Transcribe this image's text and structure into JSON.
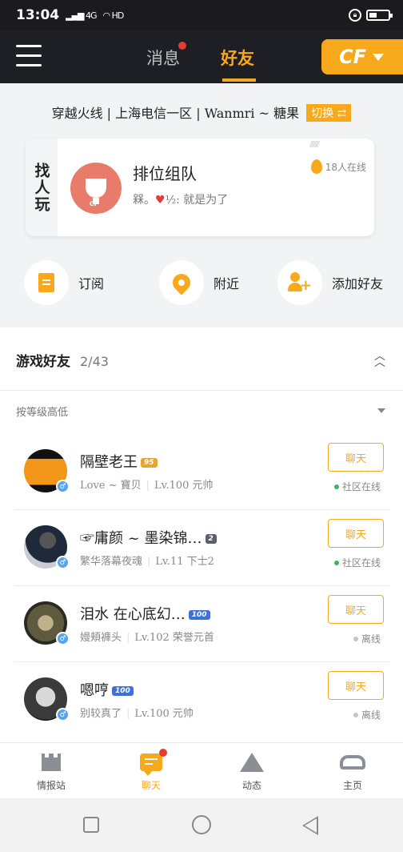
{
  "status_bar": {
    "time": "13:04",
    "network": "4G",
    "wifi": "HD"
  },
  "top_nav": {
    "tab_messages": "消息",
    "tab_friends": "好友",
    "game_button": "CF"
  },
  "server": {
    "text": "穿越火线 | 上海电信一区 | Wanmri ~ 糖果",
    "switch_label": "切换 ⇄"
  },
  "find_player": {
    "tag": "找人玩",
    "title": "排位组队",
    "subtitle_pre": "槑。",
    "subtitle_post": "½: 就是为了",
    "online": "18人在线"
  },
  "quick_actions": {
    "subscribe": "订阅",
    "nearby": "附近",
    "add_friend": "添加好友"
  },
  "friends_panel": {
    "title": "游戏好友",
    "count": "2/43",
    "sort_label": "按等级高低",
    "items": [
      {
        "name": "隔壁老王",
        "badge": "95",
        "signature": "Love ~ 寶贝",
        "level": "Lv.100 元帅",
        "chat": "聊天",
        "status": "社区在线",
        "status_color": "#3bb55e"
      },
      {
        "name": "☞庸颜 ~ 墨染锦…",
        "badge": "2",
        "signature": "繁华落幕夜魂",
        "level": "Lv.11 下士2",
        "chat": "聊天",
        "status": "社区在线",
        "status_color": "#3bb55e"
      },
      {
        "name": "泪水 在心底幻…",
        "badge": "100",
        "signature": "嫚頬褲头",
        "level": "Lv.102 荣誉元首",
        "chat": "聊天",
        "status": "离线",
        "status_color": "#c4c4c4"
      },
      {
        "name": "嗯哼",
        "badge": "100",
        "signature": "别较真了",
        "level": "Lv.100 元帅",
        "chat": "聊天",
        "status": "离线",
        "status_color": "#c4c4c4"
      }
    ]
  },
  "bottom_tabs": {
    "intel": "情报站",
    "chat": "聊天",
    "moments": "动态",
    "home": "主页"
  },
  "colors": {
    "accent": "#f7a91b",
    "dark": "#1e1f24",
    "online": "#3bb55e"
  }
}
